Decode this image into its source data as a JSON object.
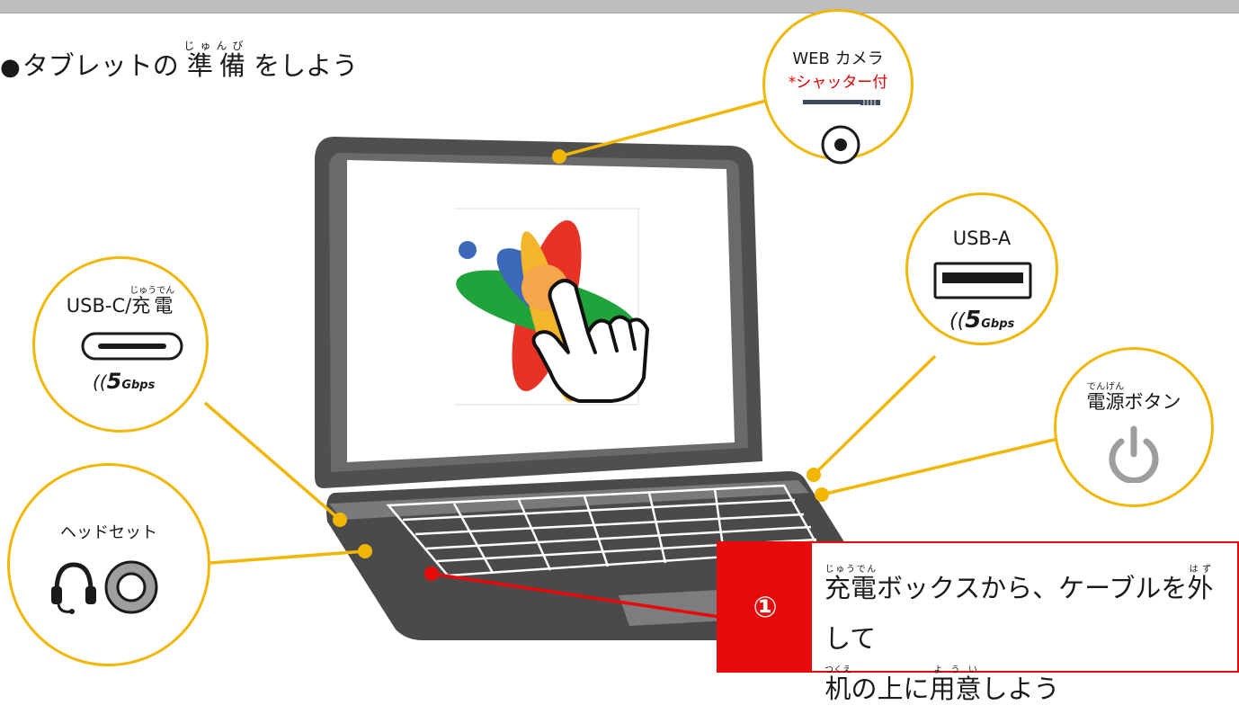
{
  "title": {
    "bullet": "●",
    "before": "タブレットの",
    "kanji": "準備",
    "ruby": "じゅんび",
    "after": "をしよう"
  },
  "labels": {
    "webcam_title": "WEB カメラ",
    "webcam_note": "*シャッター付",
    "usba_title": "USB-A",
    "usbc_prefix": "USB-C/",
    "usbc_kanji": "充電",
    "usbc_ruby": "じゅうでん",
    "power_kanji": "電源",
    "power_ruby": "でんげん",
    "power_suffix": "ボタン",
    "headset_title": "ヘッドセット",
    "speed_value": "5",
    "speed_unit": "Gbps"
  },
  "step": {
    "number": "①",
    "line1": [
      {
        "kanji": "充電",
        "ruby": "じゅうでん"
      },
      {
        "text": "ボックスから、ケーブルを"
      },
      {
        "kanji": "外",
        "ruby": "はず"
      },
      {
        "text": "して"
      }
    ],
    "line2": [
      {
        "kanji": "机",
        "ruby": "つくえ"
      },
      {
        "text": "の上に"
      },
      {
        "kanji": "用意",
        "ruby": "ようい"
      },
      {
        "text": "しよう"
      }
    ]
  },
  "colors": {
    "accent_yellow": "#f2b705",
    "callout_red": "#e8090a",
    "laptop_gray": "#555555",
    "webcam_note": "#e00000"
  },
  "icons": [
    "webcam-shutter-icon",
    "webcam-lens-icon",
    "usb-a-port-icon",
    "usb-c-port-icon",
    "5gbps-badge-icon",
    "power-icon",
    "headset-icon",
    "audio-jack-icon",
    "app-logo-icon",
    "hand-pointer-icon"
  ]
}
